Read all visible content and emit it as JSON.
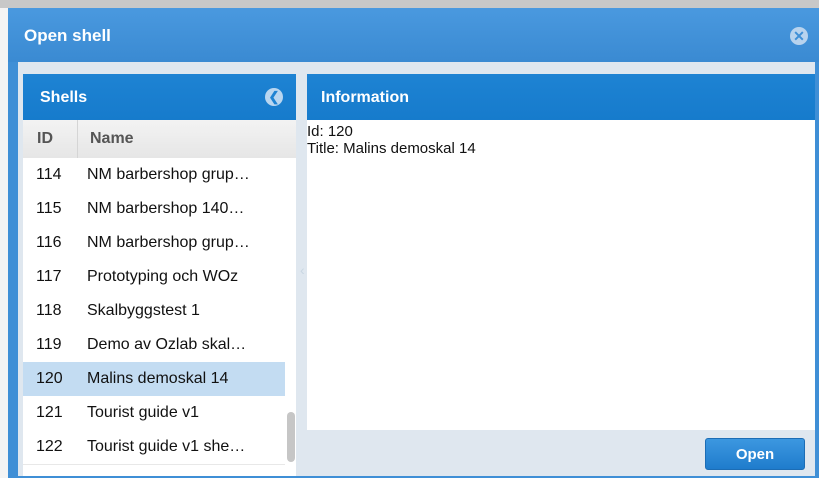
{
  "dialog": {
    "title": "Open shell",
    "close_icon": "close-icon"
  },
  "shells_panel": {
    "title": "Shells",
    "collapse_icon": "chevron-left-icon",
    "columns": [
      "ID",
      "Name"
    ],
    "rows": [
      {
        "id": "114",
        "name": "NM barbershop grup…"
      },
      {
        "id": "115",
        "name": "NM barbershop 140…"
      },
      {
        "id": "116",
        "name": "NM barbershop grup…"
      },
      {
        "id": "117",
        "name": "Prototyping och WOz"
      },
      {
        "id": "118",
        "name": "Skalbyggstest 1"
      },
      {
        "id": "119",
        "name": "Demo av Ozlab skal…"
      },
      {
        "id": "120",
        "name": "Malins demoskal 14"
      },
      {
        "id": "121",
        "name": "Tourist guide v1"
      },
      {
        "id": "122",
        "name": "Tourist guide v1 she…"
      }
    ],
    "selected_id": "120"
  },
  "info_panel": {
    "title": "Information",
    "id_line": "Id: 120",
    "title_line": "Title: Malins demoskal 14"
  },
  "footer": {
    "open_label": "Open"
  },
  "colors": {
    "accent": "#1e83d3",
    "selected_row": "#c3dcf2"
  }
}
